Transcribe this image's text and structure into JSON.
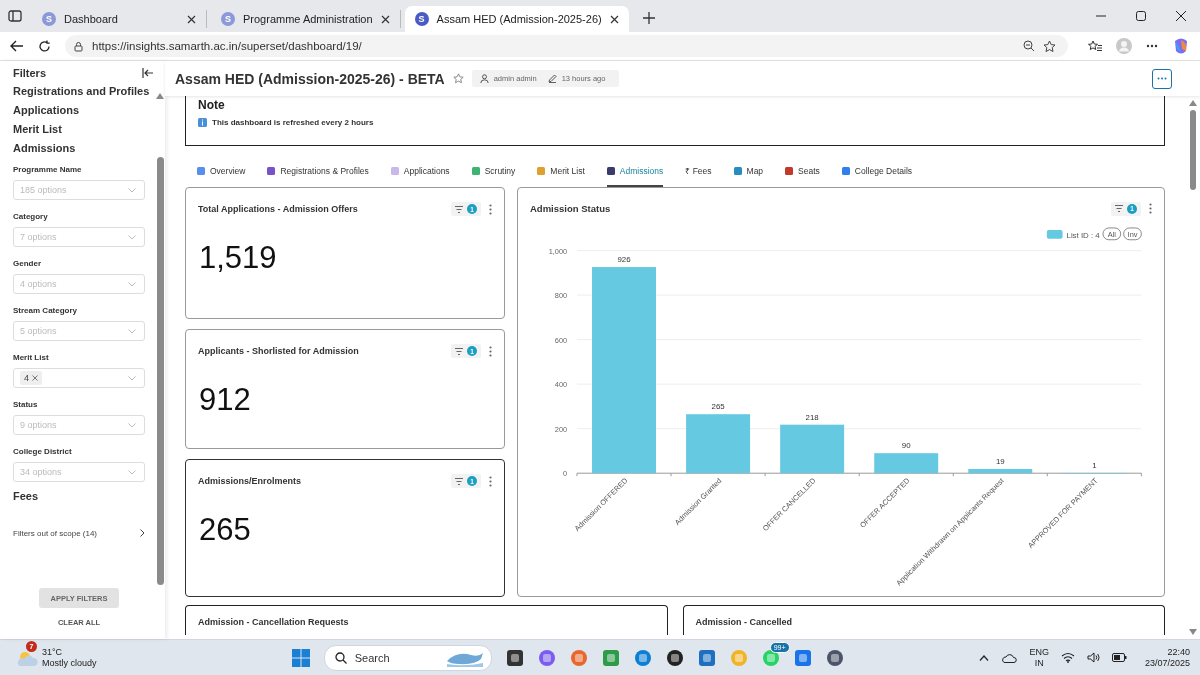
{
  "browser": {
    "tabs": [
      {
        "title": "Dashboard",
        "icon_letter": "S",
        "selected": false
      },
      {
        "title": "Programme Administration",
        "icon_letter": "S",
        "selected": false
      },
      {
        "title": "Assam HED (Admission-2025-26)",
        "icon_letter": "S",
        "selected": true
      }
    ],
    "url": "https://insights.samarth.ac.in/superset/dashboard/19/"
  },
  "filters_panel": {
    "title": "Filters",
    "sections_above": [
      "Registrations and Profiles",
      "Applications",
      "Merit List",
      "Admissions"
    ],
    "filters": [
      {
        "label": "Programme Name",
        "placeholder": "185 options"
      },
      {
        "label": "Category",
        "placeholder": "7 options"
      },
      {
        "label": "Gender",
        "placeholder": "4 options"
      },
      {
        "label": "Stream Category",
        "placeholder": "5 options"
      },
      {
        "label": "Merit List",
        "tags": [
          "4"
        ]
      },
      {
        "label": "Status",
        "placeholder": "9 options"
      },
      {
        "label": "College District",
        "placeholder": "34 options"
      }
    ],
    "sections_below": [
      "Fees"
    ],
    "out_of_scope": "Filters out of scope (14)",
    "apply": "APPLY FILTERS",
    "apply_disabled": true,
    "clear": "CLEAR ALL"
  },
  "dashboard": {
    "title": "Assam HED (Admission-2025-26) - BETA",
    "owner": "admin admin",
    "modified": "13 hours ago",
    "note": {
      "heading": "Note",
      "text": "This dashboard is refreshed every 2 hours"
    },
    "tabs": [
      {
        "label": "Overview",
        "selected": false
      },
      {
        "label": "Registrations & Profiles",
        "selected": false
      },
      {
        "label": "Applications",
        "selected": false
      },
      {
        "label": "Scrutiny",
        "selected": false
      },
      {
        "label": "Merit List",
        "selected": false
      },
      {
        "label": "Admissions",
        "selected": true
      },
      {
        "label": "₹ Fees",
        "selected": false
      },
      {
        "label": "Map",
        "selected": false
      },
      {
        "label": "Seats",
        "selected": false
      },
      {
        "label": "College Details",
        "selected": false
      }
    ],
    "cards": [
      {
        "title": "Total Applications - Admission Offers",
        "value": "1,519",
        "filter_count": "1"
      },
      {
        "title": "Applicants - Shorlisted for Admission",
        "value": "912",
        "filter_count": "1"
      },
      {
        "title": "Admissions/Enrolments",
        "value": "265",
        "filter_count": "1"
      }
    ],
    "chart_card": {
      "title": "Admission Status",
      "filter_count": "1",
      "legend_all": "All",
      "legend_inv": "Inv",
      "chart_data": {
        "type": "bar",
        "categories": [
          "Admission OFFERED",
          "Admission Granted",
          "OFFER CANCELLED",
          "OFFER ACCEPTED",
          "Application Withdrawn on Applicants Request",
          "APPROVED FOR PAYMENT"
        ],
        "series": [
          {
            "name": "List ID : 4",
            "color": "#66c9e2",
            "values": [
              926,
              265,
              218,
              90,
              19,
              1
            ]
          }
        ],
        "ylim": [
          0,
          1000
        ],
        "grid": true,
        "yticks": [
          0,
          200,
          400,
          600,
          800,
          {
            "value": 1000,
            "label": "1,000"
          }
        ],
        "data_labels": true
      }
    },
    "lower_cards": [
      {
        "title": "Admission - Cancellation Requests"
      },
      {
        "title": "Admission - Cancelled"
      }
    ]
  },
  "taskbar": {
    "weather_badge": "7",
    "temperature": "31°C",
    "condition": "Mostly cloudy",
    "search_placeholder": "Search",
    "chat_badge": "99+",
    "language": "ENG",
    "region": "IN",
    "time": "22:40",
    "date": "23/07/2025"
  }
}
